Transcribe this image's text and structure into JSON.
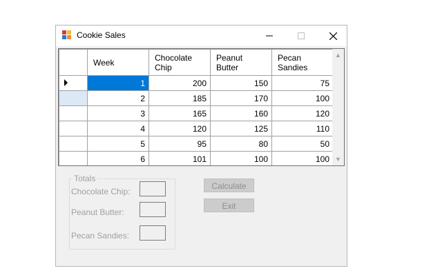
{
  "window": {
    "title": "Cookie Sales",
    "icon": "app-icon",
    "controls": {
      "minimize": "minimize-icon",
      "maximize": "maximize-icon",
      "close": "close-icon"
    }
  },
  "grid": {
    "headers": [
      "Week",
      "Chocolate Chip",
      "Peanut Butter",
      "Pecan Sandies"
    ],
    "header_lines": [
      [
        "Week"
      ],
      [
        "Chocolate",
        "Chip"
      ],
      [
        "Peanut",
        "Butter"
      ],
      [
        "Pecan",
        "Sandies"
      ]
    ],
    "rows": [
      {
        "week": "1",
        "chocolate_chip": "200",
        "peanut_butter": "150",
        "pecan_sandies": "75"
      },
      {
        "week": "2",
        "chocolate_chip": "185",
        "peanut_butter": "170",
        "pecan_sandies": "100"
      },
      {
        "week": "3",
        "chocolate_chip": "165",
        "peanut_butter": "160",
        "pecan_sandies": "120"
      },
      {
        "week": "4",
        "chocolate_chip": "120",
        "peanut_butter": "125",
        "pecan_sandies": "110"
      },
      {
        "week": "5",
        "chocolate_chip": "95",
        "peanut_butter": "80",
        "pecan_sandies": "50"
      },
      {
        "week": "6",
        "chocolate_chip": "101",
        "peanut_butter": "100",
        "pecan_sandies": "100"
      }
    ],
    "selected_color": "#0078d7"
  },
  "totals": {
    "label": "Totals",
    "chocolate_chip_label": "Chocolate Chip:",
    "peanut_butter_label": "Peanut Butter:",
    "pecan_sandies_label": "Pecan Sandies:",
    "chocolate_chip_value": "",
    "peanut_butter_value": "",
    "pecan_sandies_value": ""
  },
  "buttons": {
    "calculate": "Calculate",
    "exit": "Exit"
  }
}
